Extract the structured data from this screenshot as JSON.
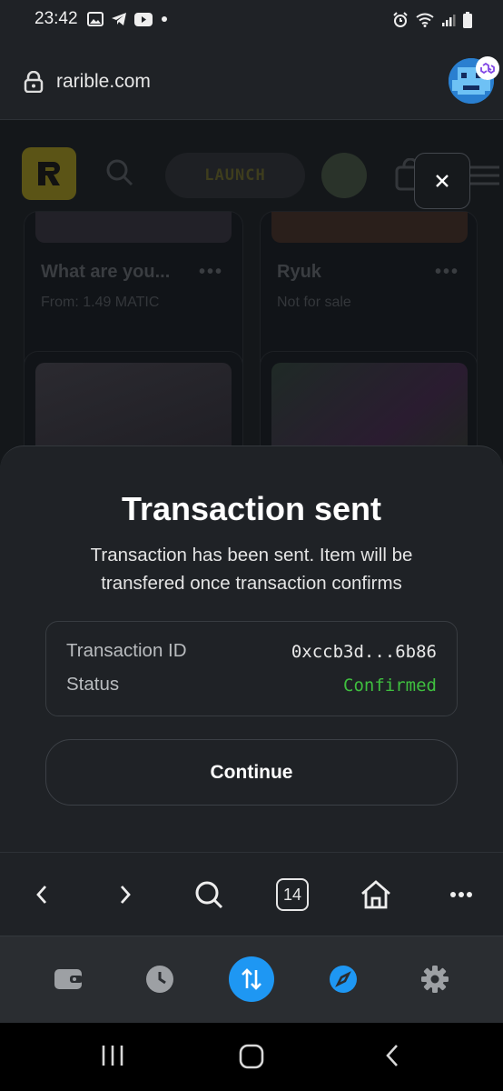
{
  "status_bar": {
    "time": "23:42"
  },
  "browser": {
    "url": "rarible.com",
    "tab_count": "14"
  },
  "page": {
    "launch_label": "LAUNCH",
    "cards": [
      {
        "title": "What are you...",
        "subtitle": "From: 1.49 MATIC"
      },
      {
        "title": "Ryuk",
        "subtitle": "Not for sale"
      }
    ]
  },
  "modal": {
    "title": "Transaction sent",
    "description": "Transaction has been sent. Item will be transfered once transaction confirms",
    "tx_id_label": "Transaction ID",
    "tx_id_value": "0xccb3d...6b86",
    "status_label": "Status",
    "status_value": "Confirmed",
    "continue_label": "Continue"
  },
  "colors": {
    "confirmed_green": "#3fbf3f",
    "accent_blue": "#1e97f3",
    "rarible_yellow": "#5b5416"
  },
  "icons": {
    "browser_bar": [
      "back-icon",
      "forward-icon",
      "search-icon",
      "tabs-icon",
      "home-icon",
      "more-icon"
    ],
    "app_nav": [
      "wallet-icon",
      "history-icon",
      "swap-icon",
      "discover-icon",
      "settings-icon"
    ]
  }
}
